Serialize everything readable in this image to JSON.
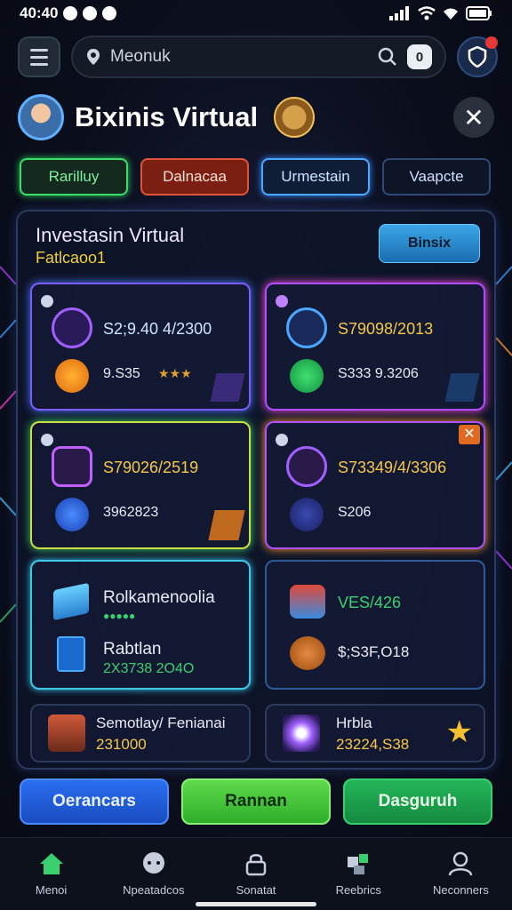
{
  "status_bar": {
    "time": "40:40"
  },
  "search": {
    "placeholder": "Meonuk"
  },
  "top_bar": {
    "square_label": "0"
  },
  "header": {
    "title": "Bixinis Virtual"
  },
  "tabs": [
    {
      "label": "Rarilluy"
    },
    {
      "label": "Dalnacaa"
    },
    {
      "label": "Urmestain"
    },
    {
      "label": "Vaapcte"
    }
  ],
  "panel": {
    "title": "Investasin Virtual",
    "subtitle": "Fatlcaoo1",
    "button_label": "Binsix"
  },
  "cards": [
    {
      "value": "S2;9.40 4/2300",
      "secondary": "9.S35"
    },
    {
      "value": "S79098/2013",
      "secondary": "S333 9.3206"
    },
    {
      "value": "S79026/2519",
      "secondary": "3962823"
    },
    {
      "value": "S73349/4/3306",
      "secondary": "S206"
    },
    {
      "title": "Rolkamenoolia",
      "title2": "Rabtlan",
      "secondary": "2X3738 2O4O"
    },
    {
      "value": "VES/426",
      "secondary": "$;S3F,O18"
    },
    {
      "title": "Semotlay/ Fenianai",
      "secondary": "231000"
    },
    {
      "title": "Hrbla",
      "secondary": "23224,S38"
    }
  ],
  "actions": [
    {
      "label": "Oerancars"
    },
    {
      "label": "Rannan"
    },
    {
      "label": "Dasguruh"
    }
  ],
  "bottom_nav": [
    {
      "label": "Menoi",
      "icon": "home-icon"
    },
    {
      "label": "Npeatadcos",
      "icon": "chat-icon"
    },
    {
      "label": "Sonatat",
      "icon": "lock-icon"
    },
    {
      "label": "Reebrics",
      "icon": "puzzle-icon"
    },
    {
      "label": "Neconners",
      "icon": "profile-icon"
    }
  ],
  "colors": {
    "accent_green": "#3ddc6a",
    "accent_blue": "#4aa8ff",
    "accent_purple": "#7a5cff",
    "value_yellow": "#f5c84a"
  }
}
